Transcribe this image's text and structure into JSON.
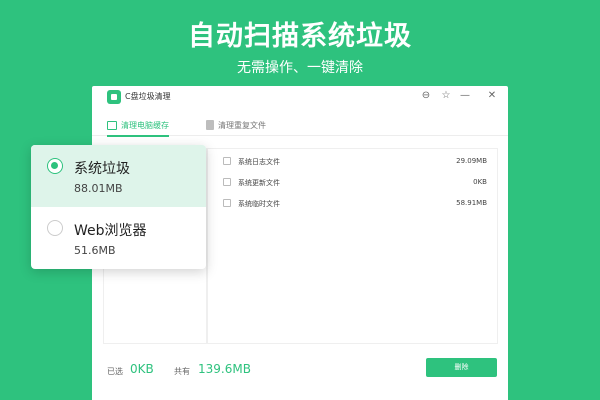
{
  "hero": {
    "title": "自动扫描系统垃圾",
    "subtitle": "无需操作、一键清除"
  },
  "window": {
    "app_title": "C盘垃圾清理",
    "controls": [
      "⊖",
      "☆",
      "—",
      "✕"
    ],
    "tabs": [
      {
        "label": "清理电脑缓存",
        "active": true,
        "icon": "monitor-icon"
      },
      {
        "label": "清理重复文件",
        "active": false,
        "icon": "document-icon"
      }
    ]
  },
  "files": [
    {
      "name": "系统日志文件",
      "size": "29.09MB",
      "checked": false
    },
    {
      "name": "系统更新文件",
      "size": "0KB",
      "checked": false
    },
    {
      "name": "系统临时文件",
      "size": "58.91MB",
      "checked": false
    }
  ],
  "footer": {
    "selected_label": "已选",
    "selected_value": "0KB",
    "total_label": "共有",
    "total_value": "139.6MB",
    "delete_label": "删除"
  },
  "categories": [
    {
      "name": "系统垃圾",
      "size": "88.01MB",
      "selected": true
    },
    {
      "name": "Web浏览器",
      "size": "51.6MB",
      "selected": false
    }
  ],
  "colors": {
    "accent": "#2ec27e",
    "selected_bg": "#def4ea"
  }
}
